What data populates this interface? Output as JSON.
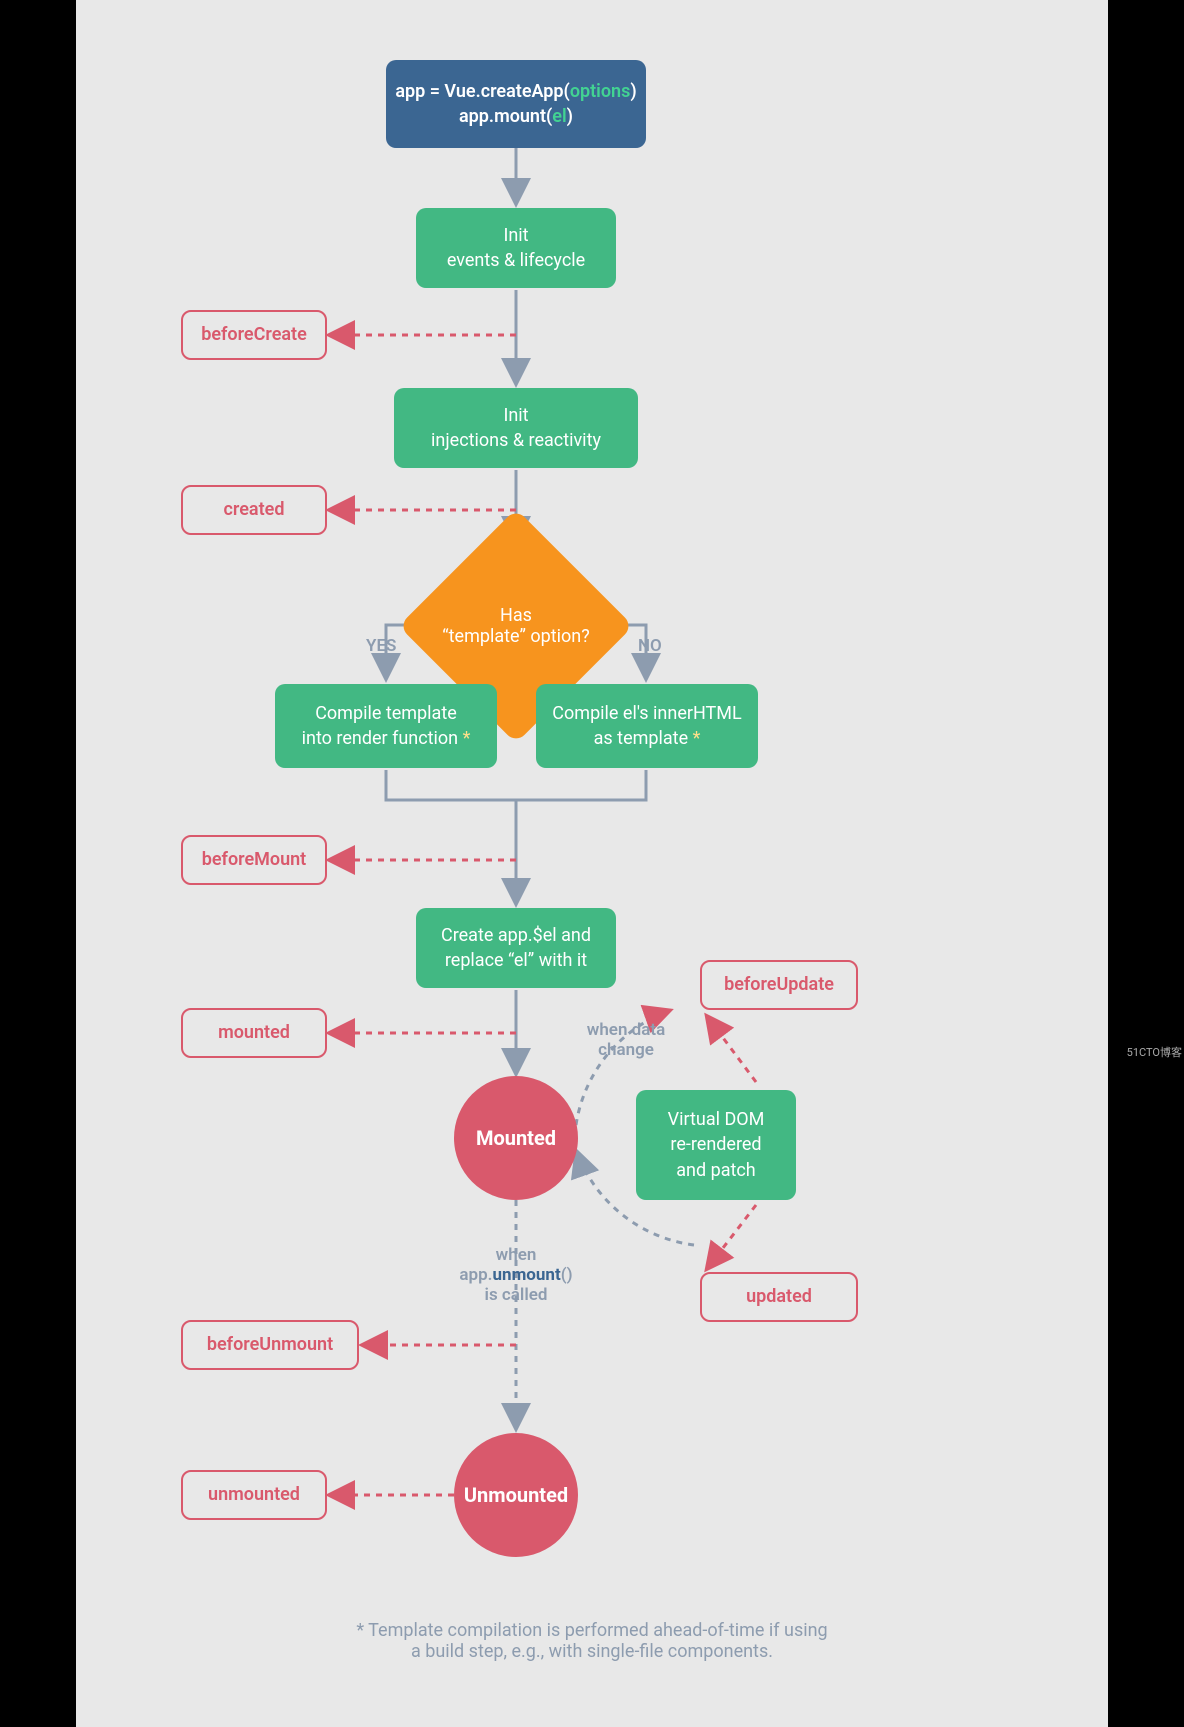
{
  "topbox": {
    "line1_pre": "app = Vue.",
    "line1_fn": "createApp(",
    "line1_arg": "options",
    "line1_post": ")",
    "line2_pre": "app.",
    "line2_fn": "mount(",
    "line2_arg": "el",
    "line2_post": ")"
  },
  "init_events": {
    "line1": "Init",
    "line2": "events & lifecycle"
  },
  "init_inject": {
    "line1": "Init",
    "line2": "injections & reactivity"
  },
  "decision": {
    "line1": "Has",
    "line2": "“template” option?"
  },
  "yes": "YES",
  "no": "NO",
  "compile_left": {
    "line1": "Compile template",
    "line2": "into render function"
  },
  "compile_right": {
    "line1": "Compile el's innerHTML",
    "line2": "as template"
  },
  "create_el": {
    "line1": "Create app.$el and",
    "line2": "replace “el” with it"
  },
  "mounted_circle": "Mounted",
  "unmounted_circle": "Unmounted",
  "vdom": {
    "line1": "Virtual DOM",
    "line2": "re-rendered",
    "line3": "and patch"
  },
  "hooks": {
    "beforeCreate": "beforeCreate",
    "created": "created",
    "beforeMount": "beforeMount",
    "mounted": "mounted",
    "beforeUpdate": "beforeUpdate",
    "updated": "updated",
    "beforeUnmount": "beforeUnmount",
    "unmounted": "unmounted"
  },
  "labels": {
    "when_data": "when data",
    "change": "change",
    "when_unmount1": "when",
    "when_unmount2_pre": "app.",
    "when_unmount2_fn": "unmount",
    "when_unmount2_post": "()",
    "when_unmount3": "is called"
  },
  "footnote": {
    "line1": "* Template compilation is performed ahead-of-time if using",
    "line2": "a build step, e.g., with single-file components."
  },
  "watermark": "51CTO博客",
  "colors": {
    "blue": "#3b6692",
    "green": "#42b883",
    "red": "#d9596c",
    "orange": "#f7941e",
    "gray": "#8d9caf"
  }
}
